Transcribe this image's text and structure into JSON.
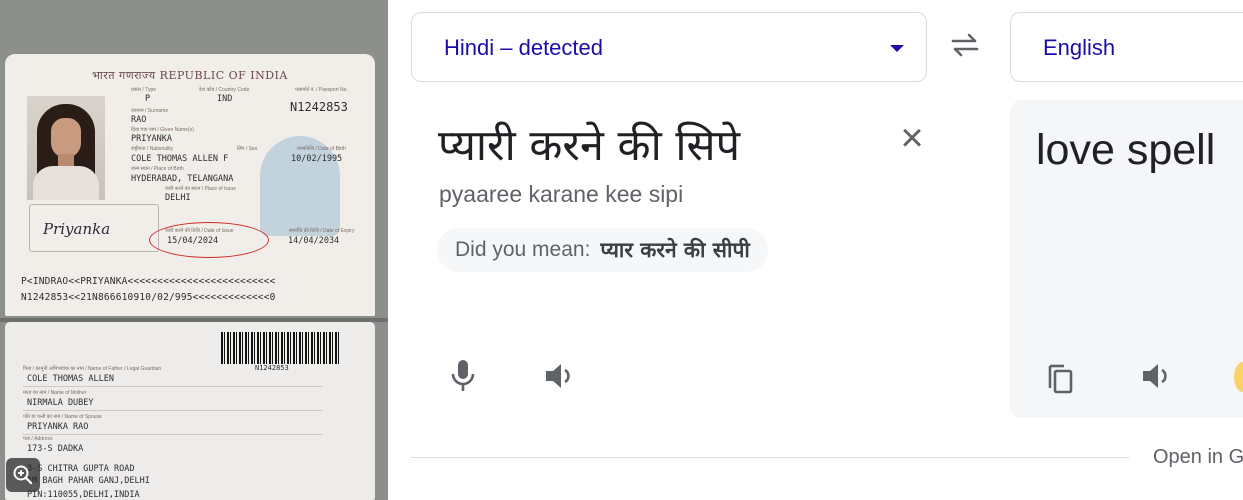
{
  "passport": {
    "header": "भारत गणराज्य REPUBLIC OF INDIA",
    "type_label": "प्रकार / Type",
    "type": "P",
    "country_code_label": "देश कोड / Country Code",
    "country_code": "IND",
    "passport_no_label": "पासपोर्ट नं. / Passport No.",
    "passport_no": "N1242853",
    "surname_label": "उपनाम / Surname",
    "surname": "RAO",
    "given_names_label": "दिया गया नाम / Given Name(s)",
    "given_names": "PRIYANKA",
    "nationality_label": "राष्ट्रीयता / Nationality",
    "sex_label": "लिंग / Sex",
    "nationality_line": "COLE THOMAS ALLEN F",
    "dob_label": "जन्मतिथि / Date of Birth",
    "dob": "10/02/1995",
    "pob_label": "जन्म स्थान / Place of Birth",
    "pob": "HYDERABAD, TELANGANA",
    "poi_label": "जारी करने का स्थान / Place of Issue",
    "poi": "DELHI",
    "doi_label": "जारी करने की तिथि / Date of Issue",
    "doi": "15/04/2024",
    "doe_label": "समाप्ति की तिथि / Date of Expiry",
    "doe": "14/04/2034",
    "signature": "Priyanka",
    "mrz1": "P<INDRAO<<PRIYANKA<<<<<<<<<<<<<<<<<<<<<<<<<",
    "mrz2": "N1242853<<21N866610910/02/995<<<<<<<<<<<<<0",
    "barcode_no": "N1242853",
    "father_label": "पिता / कानूनी अभिभावक का नाम / Name of Father / Legal Guardian",
    "father": "COLE THOMAS ALLEN",
    "mother_label": "माता का नाम / Name of Mother",
    "mother": "NIRMALA DUBEY",
    "spouse_label": "पति या पत्नी का नाम / Name of Spouse",
    "spouse": "PRIYANKA RAO",
    "address_label": "पता / Address",
    "address1": "173-S DADKA",
    "address2": "3-S CHITRA GUPTA ROAD",
    "address3": "AM BAGH PAHAR GANJ,DELHI",
    "address4": "PIN:110055,DELHI,INDIA"
  },
  "translate": {
    "source_lang": "Hindi – detected",
    "target_lang": "English",
    "source_text": "प्यारी करने की सिपे",
    "transliteration": "pyaaree karane kee sipi",
    "did_you_mean_label": "Did you mean:",
    "did_you_mean_suggestion": "प्यार करने की सीपी",
    "translation": "love spell",
    "open_in": "Open in G",
    "colors": {
      "accent": "#1a0dab",
      "icon": "#5f6368",
      "text": "#202124",
      "panel": "#f5f6f7"
    }
  }
}
